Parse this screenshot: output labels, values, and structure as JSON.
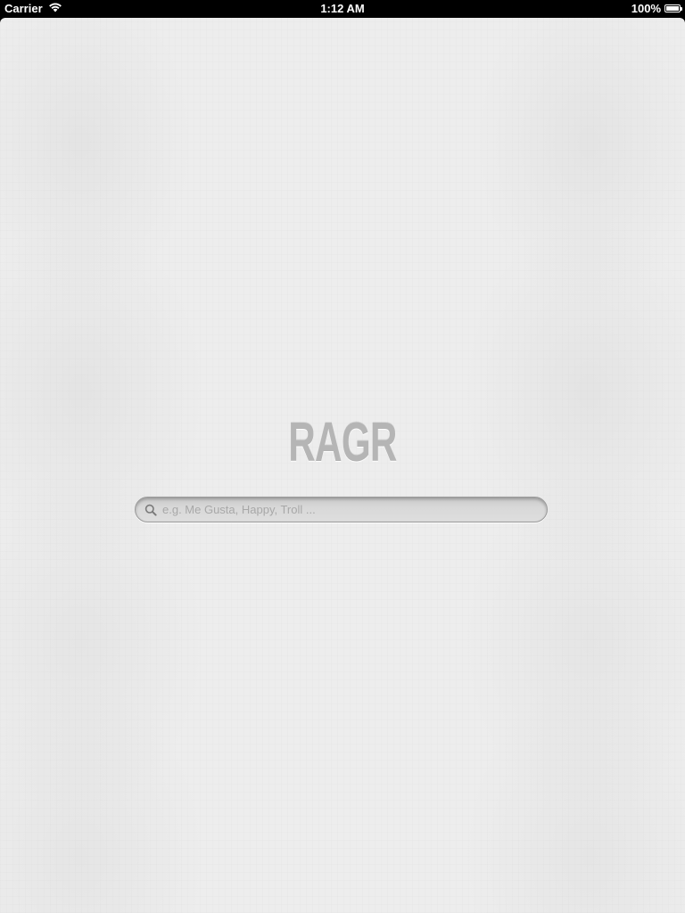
{
  "status_bar": {
    "carrier": "Carrier",
    "time": "1:12 AM",
    "battery_percent": "100%",
    "battery_level": 1.0,
    "wifi_icon": "wifi-icon",
    "battery_icon": "battery-icon"
  },
  "app": {
    "logo": "RAGR"
  },
  "search": {
    "placeholder": "e.g. Me Gusta, Happy, Troll ...",
    "value": "",
    "icon": "search-icon"
  }
}
